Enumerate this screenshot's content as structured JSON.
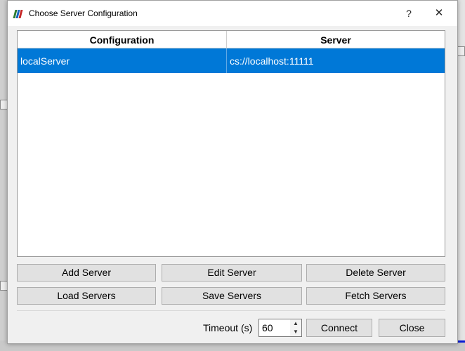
{
  "window": {
    "title": "Choose Server Configuration",
    "help_label": "?",
    "close_label": "✕"
  },
  "table": {
    "headers": [
      "Configuration",
      "Server"
    ],
    "rows": [
      {
        "configuration": "localServer",
        "server": "cs://localhost:11111",
        "selected": true
      }
    ]
  },
  "buttons": {
    "add": "Add Server",
    "edit": "Edit Server",
    "delete": "Delete Server",
    "load": "Load Servers",
    "save": "Save Servers",
    "fetch": "Fetch Servers",
    "connect": "Connect",
    "close": "Close"
  },
  "timeout": {
    "label": "Timeout (s)",
    "value": "60"
  },
  "colors": {
    "selection": "#0078d7",
    "button_bg": "#e1e1e1",
    "dialog_bg": "#f0f0f0"
  }
}
